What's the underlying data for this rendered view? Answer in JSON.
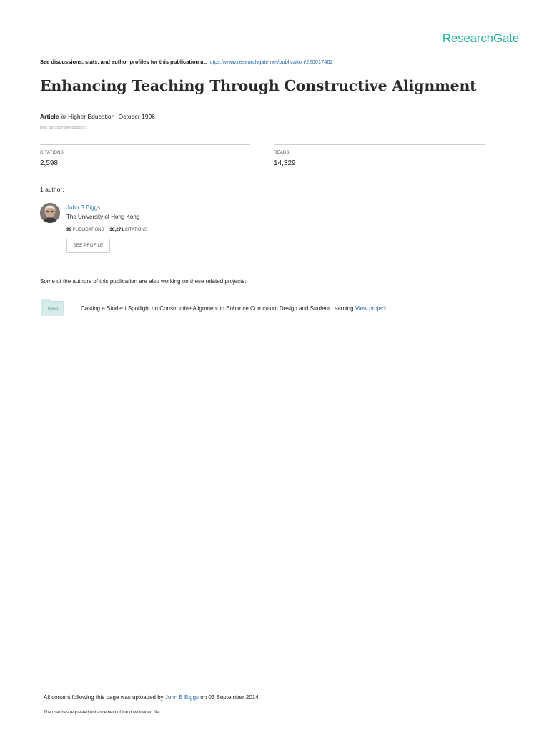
{
  "brand": "ResearchGate",
  "discussion": {
    "prefix": "See discussions, stats, and author profiles for this publication at:",
    "url": "https://www.researchgate.net/publication/220017462"
  },
  "publication": {
    "title": "Enhancing Teaching Through Constructive Alignment",
    "type": "Article",
    "in_word": "in",
    "journal": "Higher Education",
    "date_sep": "·",
    "date": "October 1996",
    "doi": "DOI: 10.1007/BF00138871"
  },
  "stats": {
    "citations_label": "CITATIONS",
    "citations_value": "2,598",
    "reads_label": "READS",
    "reads_value": "14,329"
  },
  "authors": {
    "heading": "1 author:",
    "items": [
      {
        "name": "John B Biggs",
        "institution": "The University of Hong Kong",
        "publications_count": "99",
        "publications_label": "PUBLICATIONS",
        "citations_count": "30,271",
        "citations_label": "CITATIONS",
        "see_profile_label": "SEE PROFILE"
      }
    ]
  },
  "related": {
    "heading": "Some of the authors of this publication are also working on these related projects:",
    "projects": [
      {
        "icon_label": "Project",
        "title": "Casting a Student Spotlight on Constructive Alignment to Enhance Curriculum Design and Student Learning",
        "link_label": "View project"
      }
    ]
  },
  "footer": {
    "uploaded_prefix": "All content following this page was uploaded by",
    "uploader": "John B Biggs",
    "uploaded_suffix": "on 03 September 2014.",
    "note": "The user has requested enhancement of the downloaded file."
  },
  "colors": {
    "brand": "#27b59b",
    "link": "#2b6aa7"
  }
}
